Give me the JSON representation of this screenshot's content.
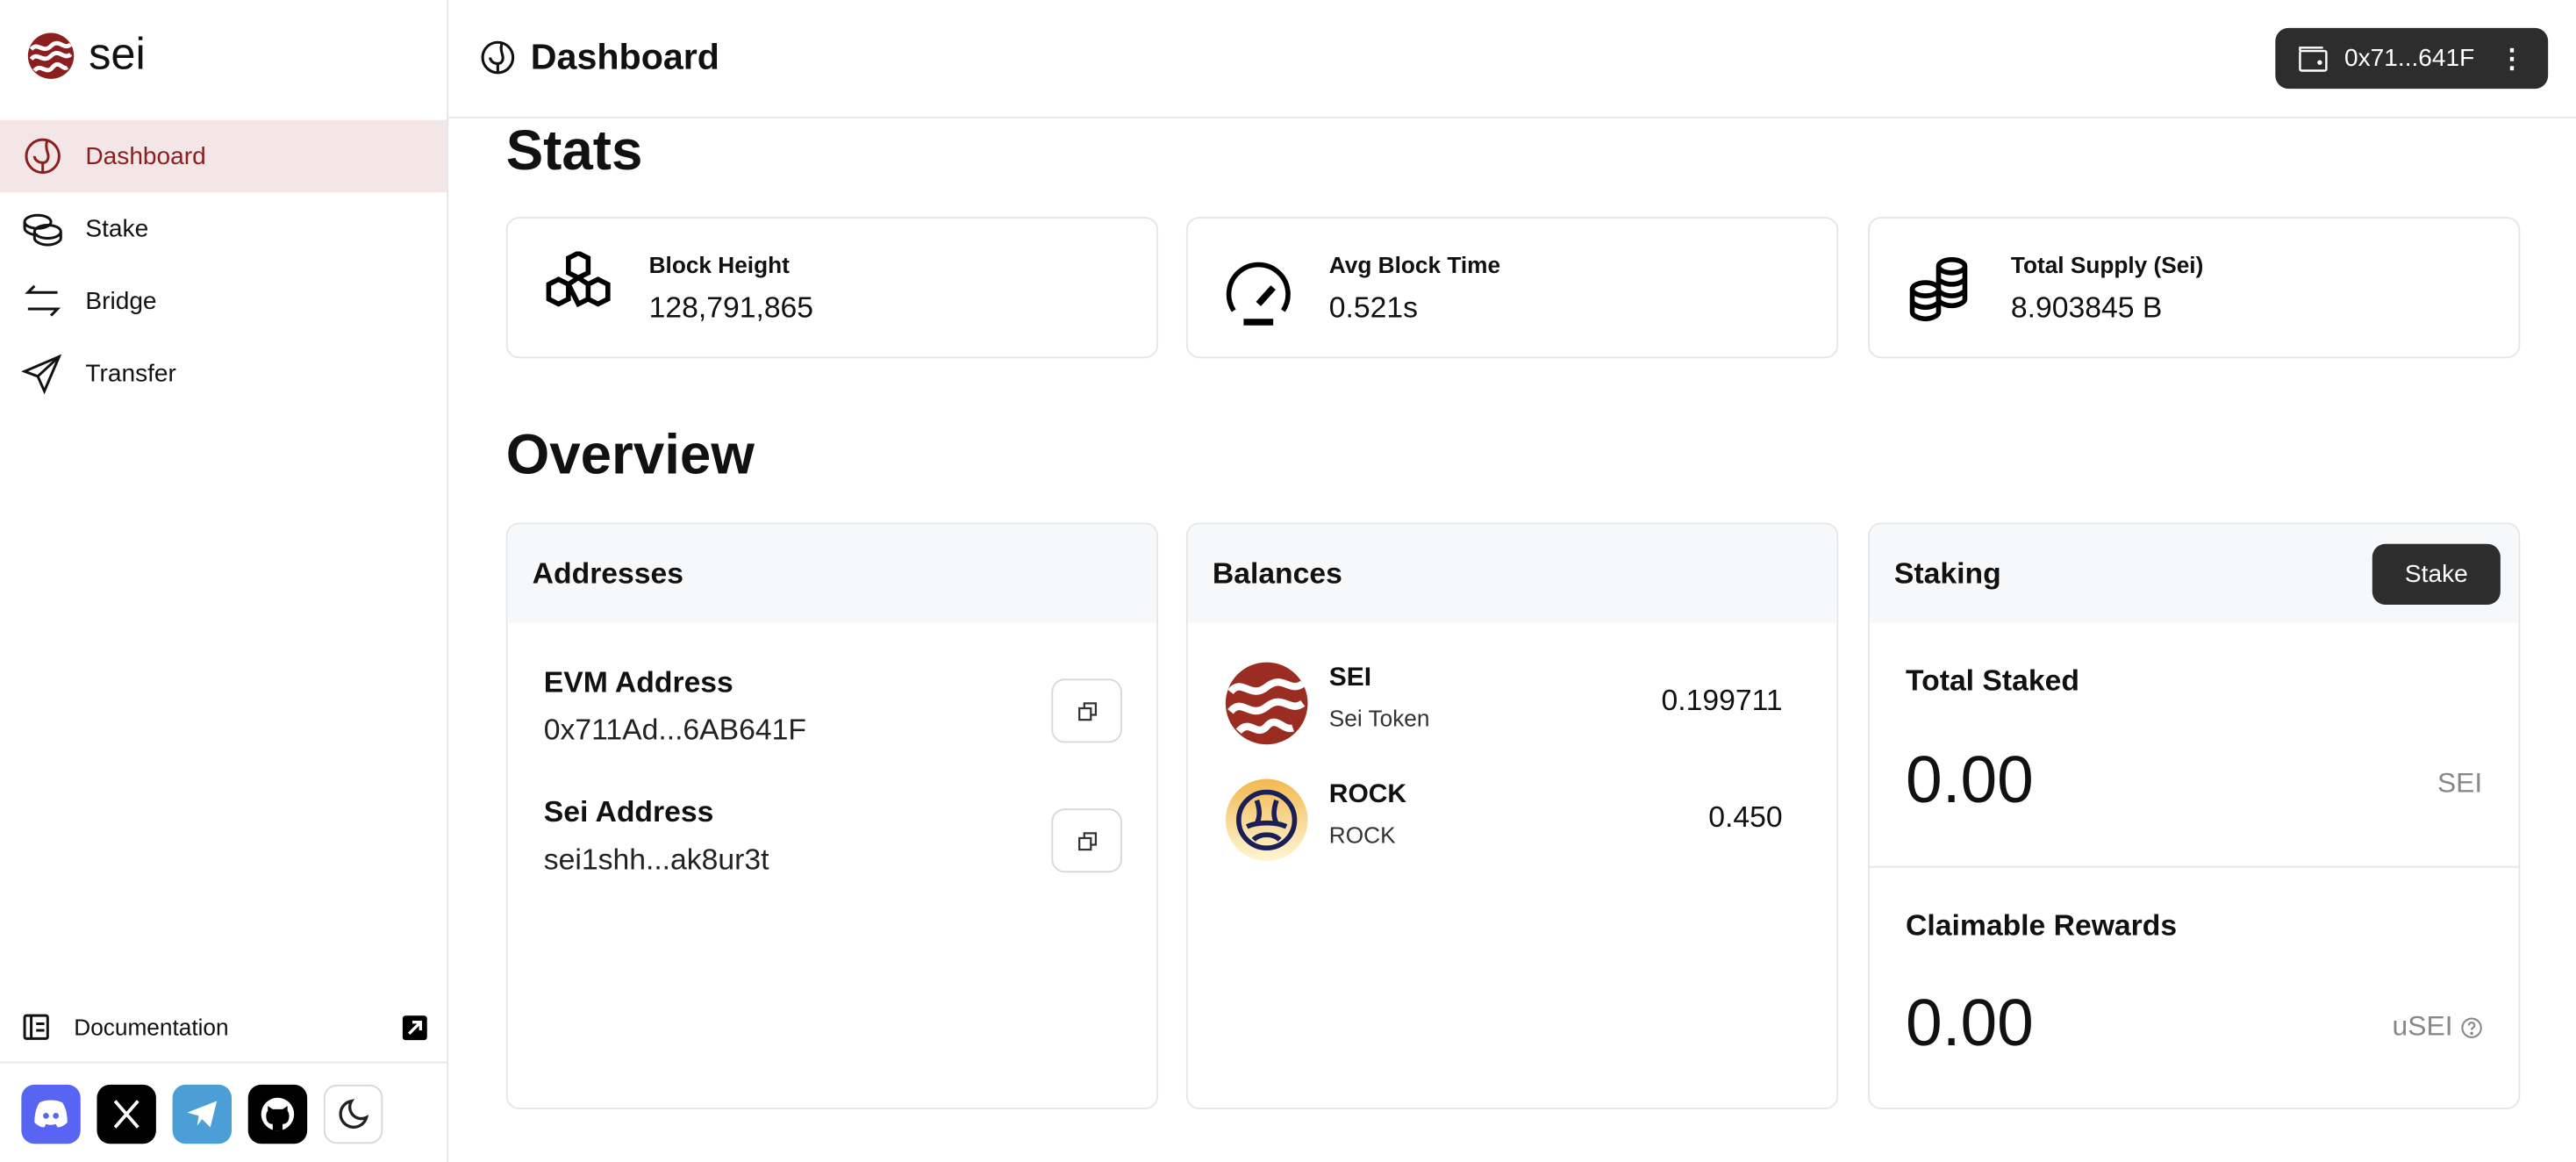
{
  "app": {
    "logo_text": "sei",
    "brand_color": "#8b1e1e"
  },
  "sidebar": {
    "items": [
      {
        "label": "Dashboard",
        "icon": "dashboard-icon",
        "active": true
      },
      {
        "label": "Stake",
        "icon": "coins-icon"
      },
      {
        "label": "Bridge",
        "icon": "arrows-icon"
      },
      {
        "label": "Transfer",
        "icon": "send-icon"
      }
    ],
    "docs_label": "Documentation",
    "socials": [
      "discord-icon",
      "x-icon",
      "telegram-icon",
      "github-icon",
      "moon-icon"
    ]
  },
  "header": {
    "title": "Dashboard",
    "wallet": "0x71...641F"
  },
  "stats": {
    "heading": "Stats",
    "cards": [
      {
        "label": "Block Height",
        "value": "128,791,865"
      },
      {
        "label": "Avg Block Time",
        "value": "0.521s"
      },
      {
        "label": "Total Supply (Sei)",
        "value": "8.903845 B"
      }
    ]
  },
  "overview": {
    "heading": "Overview",
    "addresses": {
      "title": "Addresses",
      "items": [
        {
          "label": "EVM Address",
          "value": "0x711Ad...6AB641F"
        },
        {
          "label": "Sei Address",
          "value": "sei1shh...ak8ur3t"
        }
      ]
    },
    "balances": {
      "title": "Balances",
      "tokens": [
        {
          "name": "SEI",
          "sub": "Sei Token",
          "balance": "0.199711"
        },
        {
          "name": "ROCK",
          "sub": "ROCK",
          "balance": "0.450"
        }
      ]
    },
    "staking": {
      "title": "Staking",
      "button": "Stake",
      "total_label": "Total Staked",
      "total_value": "0.00",
      "total_unit": "SEI",
      "rewards_label": "Claimable Rewards",
      "rewards_value": "0.00",
      "rewards_unit": "uSEI"
    }
  }
}
